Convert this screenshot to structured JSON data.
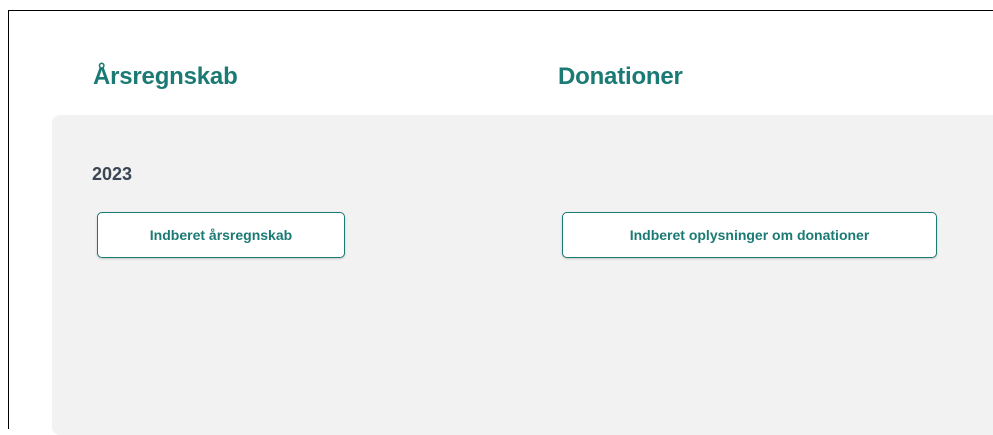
{
  "columns": {
    "arsregnskab": {
      "heading": "Årsregnskab",
      "year": "2023",
      "button_label": "Indberet årsregnskab"
    },
    "donationer": {
      "heading": "Donationer",
      "button_label": "Indberet oplysninger om donationer"
    }
  },
  "colors": {
    "accent": "#1b7a73",
    "panel_background": "#f2f2f2",
    "year_text": "#3a4653"
  }
}
